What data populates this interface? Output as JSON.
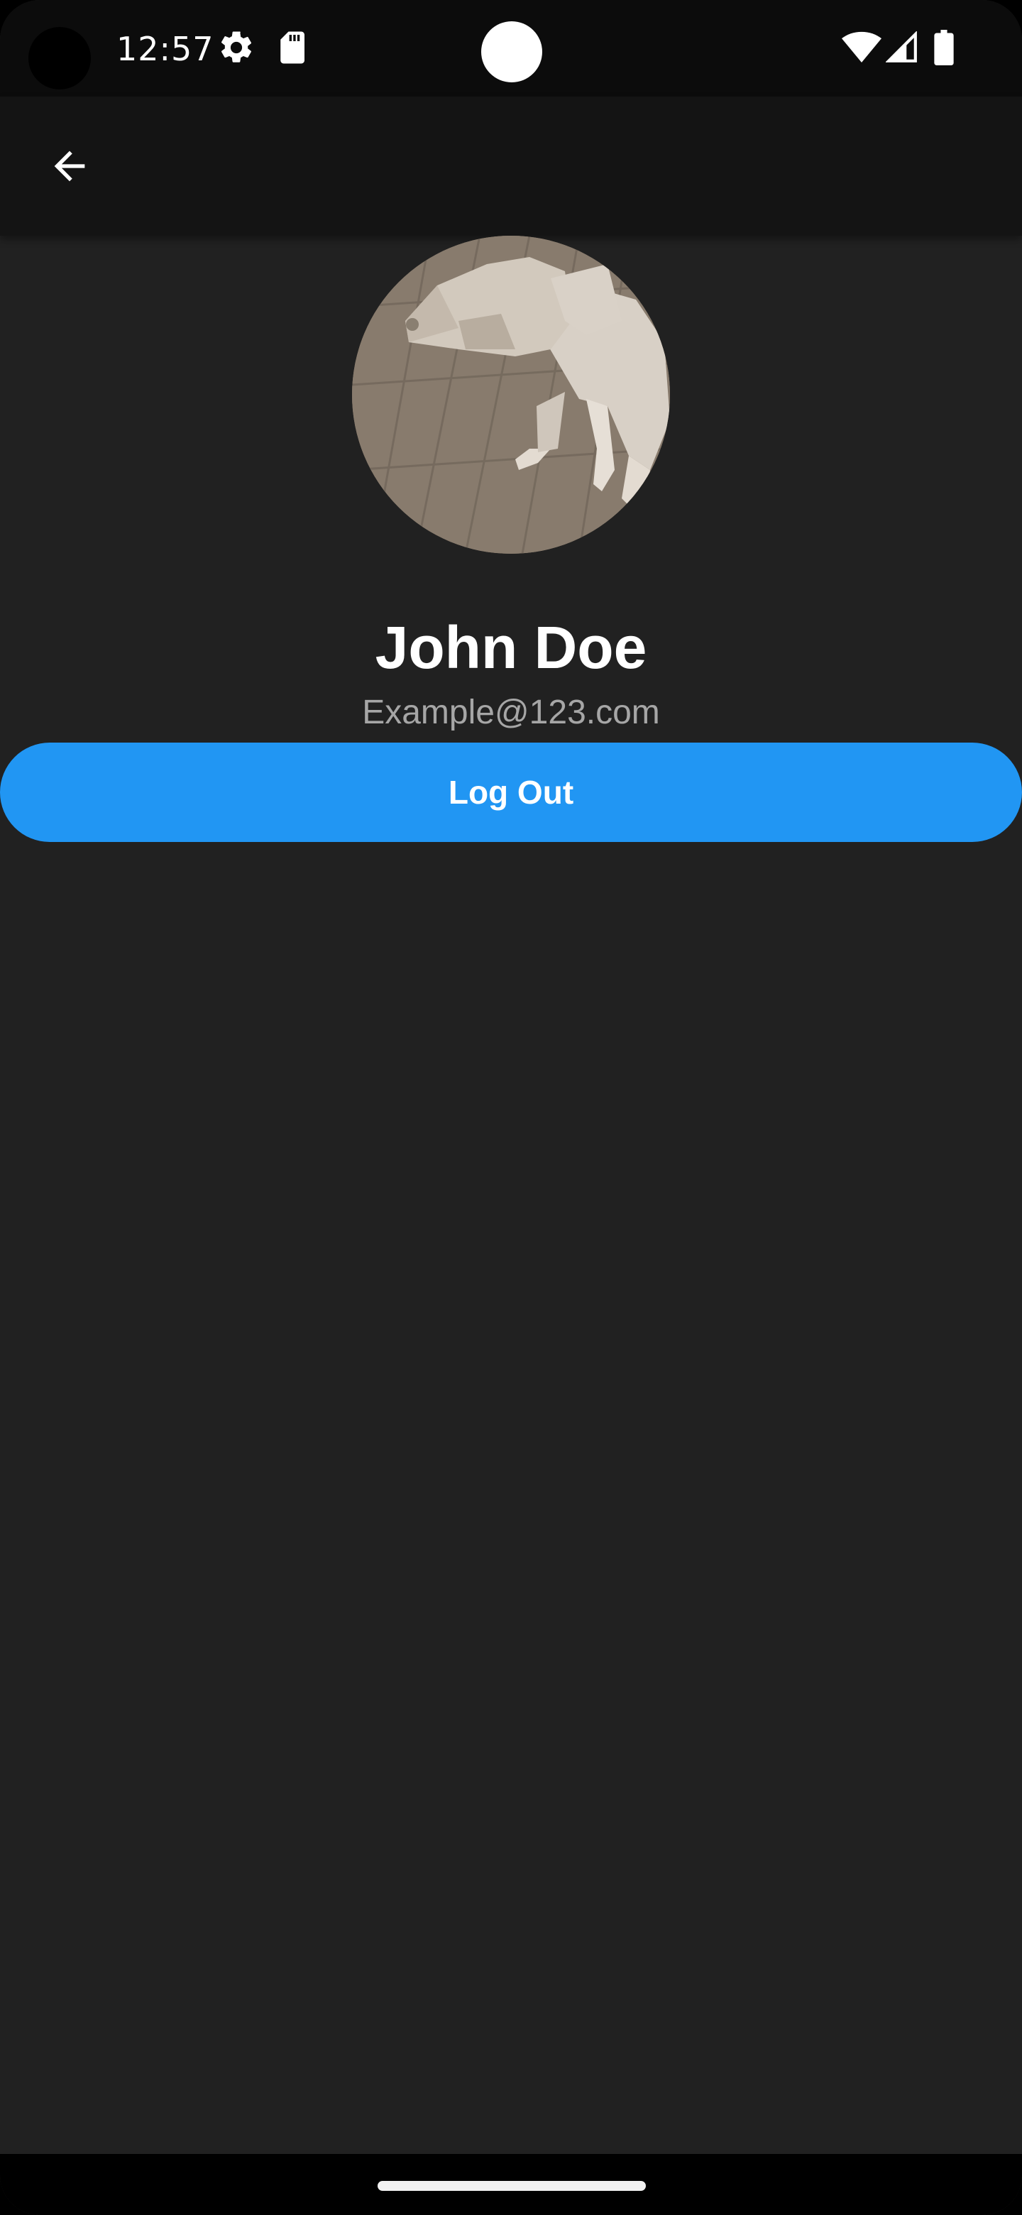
{
  "status_bar": {
    "time": "12:57",
    "icons": [
      "settings-gear-icon",
      "sd-card-icon",
      "wifi-icon",
      "cell-signal-icon",
      "battery-icon"
    ]
  },
  "app_bar": {
    "back_icon": "arrow-back-icon"
  },
  "profile": {
    "name": "John Doe",
    "email": "Example@123.com",
    "avatar": "dog-photo"
  },
  "actions": {
    "logout_label": "Log Out"
  },
  "colors": {
    "background": "#212121",
    "app_bar": "#141414",
    "status_bar": "#0c0c0c",
    "accent": "#2196f3",
    "name_text": "#ffffff",
    "email_text": "#a6a6a6"
  }
}
